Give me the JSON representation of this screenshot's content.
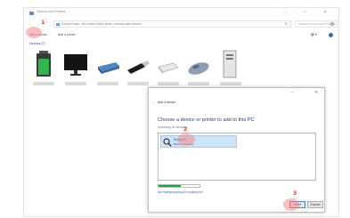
{
  "window": {
    "title": "Devices and Printers",
    "minimize": "–",
    "maximize": "□",
    "close": "✕"
  },
  "address": {
    "back": "←",
    "forward": "→",
    "up": "↑",
    "path": "Control Panel  ›  All Control Panel Items  ›  Devices and Printers",
    "refresh": "↻",
    "search_placeholder": "Search Devices and Printers"
  },
  "commandbar": {
    "add_device": "Add a device",
    "add_printer": "Add a printer",
    "view": "▦ ▾",
    "help": "?"
  },
  "section": {
    "label": "Devices (7)"
  },
  "devices": [
    {
      "name": "battery-icon"
    },
    {
      "name": "monitor-icon"
    },
    {
      "name": "drive-icon"
    },
    {
      "name": "usb-drive-icon"
    },
    {
      "name": "usb-stick-icon"
    },
    {
      "name": "mouse-icon"
    },
    {
      "name": "computer-tower-icon"
    }
  ],
  "dialog": {
    "title": "Add a device",
    "back": "←",
    "heading": "Choose a device or printer to add to this PC",
    "searching": "Searching for devices...",
    "item_name": "Bluetooth",
    "item_desc": "Bluetooth device",
    "progress": 0.55,
    "not_found_link": "Not finding what you're looking for?",
    "next": "Next",
    "cancel": "Cancel",
    "close": "✕",
    "minimize": "–"
  },
  "markers": {
    "step1": "1",
    "step2": "2",
    "step3": "3"
  },
  "colors": {
    "accent": "#2f6bc4",
    "progress": "#1fa842",
    "highlight": "#f58c8c",
    "step": "#e23a2e"
  }
}
